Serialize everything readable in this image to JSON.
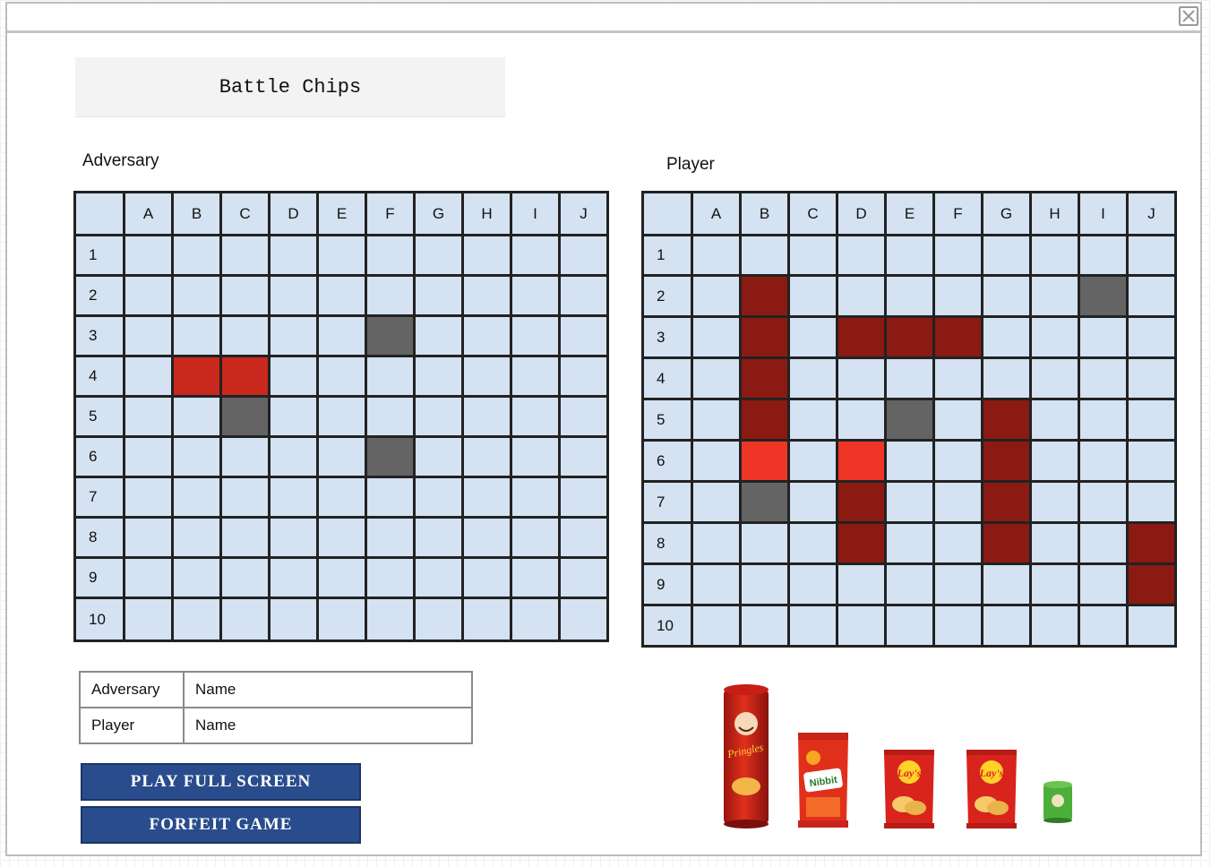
{
  "app": {
    "title": "Battle Chips"
  },
  "columns": [
    "A",
    "B",
    "C",
    "D",
    "E",
    "F",
    "G",
    "H",
    "I",
    "J"
  ],
  "rows": [
    "1",
    "2",
    "3",
    "4",
    "5",
    "6",
    "7",
    "8",
    "9",
    "10"
  ],
  "adversary_board": {
    "label": "Adversary",
    "cells": {
      "B4": "hit",
      "C4": "hit",
      "F3": "miss",
      "C5": "miss",
      "F6": "miss"
    }
  },
  "player_board": {
    "label": "Player",
    "cells": {
      "B2": "ship",
      "B3": "ship",
      "B4": "ship",
      "B5": "ship",
      "B6": "shiphit",
      "B7": "miss",
      "D3": "ship",
      "E3": "ship",
      "F3": "ship",
      "D6": "shiphit",
      "D7": "ship",
      "D8": "ship",
      "E5": "miss",
      "G5": "ship",
      "G6": "ship",
      "G7": "ship",
      "G8": "ship",
      "I2": "miss",
      "J8": "ship",
      "J9": "ship"
    }
  },
  "names_table": {
    "rows": [
      {
        "role": "Adversary",
        "name": "Name"
      },
      {
        "role": "Player",
        "name": "Name"
      }
    ]
  },
  "buttons": {
    "play_full_screen": "PLAY FULL SCREEN",
    "forfeit_game": "FORFEIT GAME"
  },
  "snacks": [
    {
      "icon": "pringles-can-icon",
      "text": "Pringles",
      "color": "#d0201c"
    },
    {
      "icon": "nibbit-bag-icon",
      "text": "Nibbit",
      "color": "#e0301c"
    },
    {
      "icon": "lays-bag-icon",
      "text": "Lay's",
      "color": "#d8241c"
    },
    {
      "icon": "lays-bag-icon",
      "text": "Lay's",
      "color": "#d8241c"
    },
    {
      "icon": "small-green-can-icon",
      "color": "#4caf3a"
    }
  ],
  "colors": {
    "cell": "#d4e2f1",
    "hit": "#c9291c",
    "miss": "#646464",
    "ship": "#8b1a12",
    "ship_hit": "#ee3526",
    "button": "#294c8c"
  }
}
